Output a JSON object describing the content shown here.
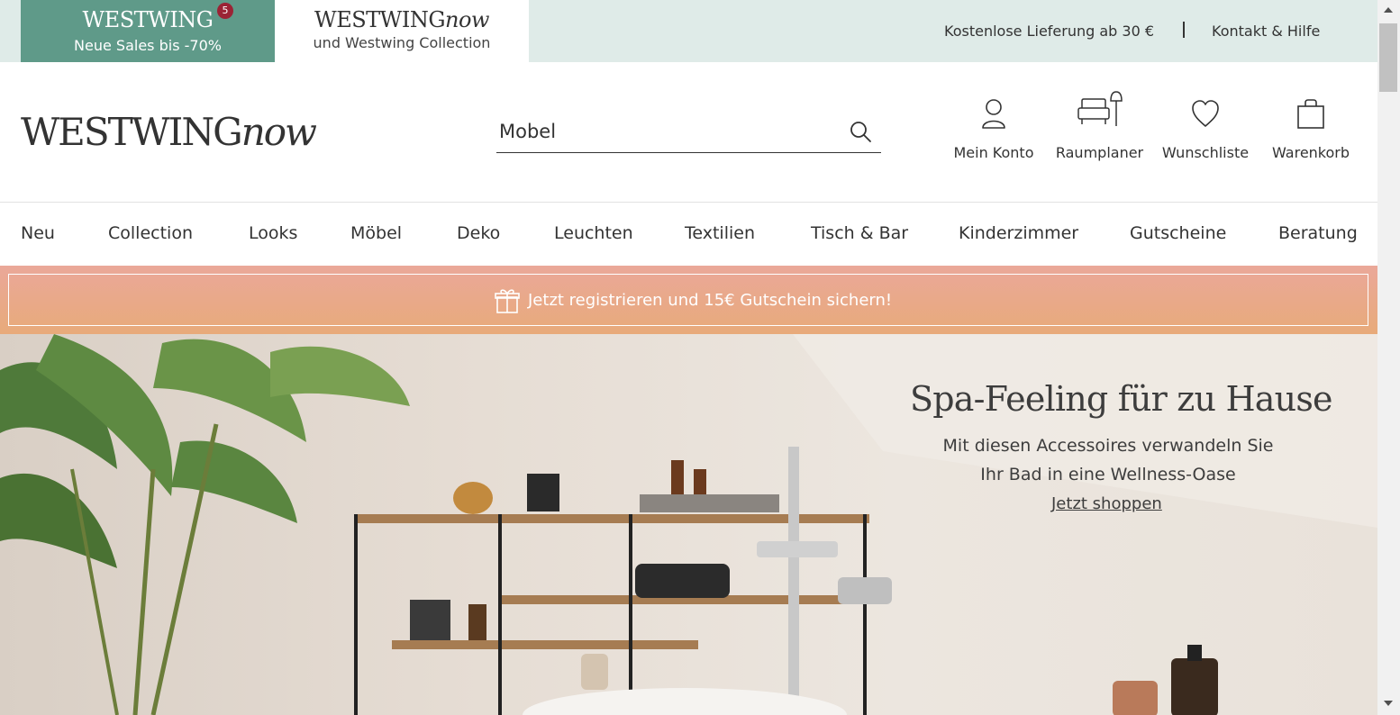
{
  "topbar": {
    "sales_tab": {
      "brand": "WESTWING",
      "badge": "5",
      "subtitle": "Neue Sales bis -70%"
    },
    "now_tab": {
      "brand_main": "WESTWING",
      "brand_italic": "now",
      "subtitle": "und Westwing Collection"
    },
    "delivery_text": "Kostenlose Lieferung ab 30 €",
    "help_link": "Kontakt & Hilfe"
  },
  "header": {
    "logo_main": "WESTWING",
    "logo_italic": "now",
    "search": {
      "value": "Mobel",
      "icon": "search-icon"
    },
    "actions": [
      {
        "label": "Mein Konto",
        "icon": "user-icon"
      },
      {
        "label": "Raumplaner",
        "icon": "room-planner-icon"
      },
      {
        "label": "Wunschliste",
        "icon": "heart-icon"
      },
      {
        "label": "Warenkorb",
        "icon": "shopping-bag-icon"
      }
    ]
  },
  "nav": {
    "items": [
      "Neu",
      "Collection",
      "Looks",
      "Möbel",
      "Deko",
      "Leuchten",
      "Textilien",
      "Tisch & Bar",
      "Kinderzimmer",
      "Gutscheine",
      "Beratung"
    ]
  },
  "promo": {
    "icon": "gift-icon",
    "text": "Jetzt registrieren und 15€ Gutschein sichern!"
  },
  "hero": {
    "title": "Spa-Feeling für zu Hause",
    "subtitle_line1": "Mit diesen Accessoires verwandeln Sie",
    "subtitle_line2": "Ihr Bad in eine Wellness-Oase",
    "cta": "Jetzt shoppen"
  },
  "colors": {
    "topbar_bg": "#dfebe8",
    "sales_tab_bg": "#5f9a89",
    "badge_bg": "#9b2335",
    "promo_bg": "#e8aa85",
    "text": "#333333"
  }
}
